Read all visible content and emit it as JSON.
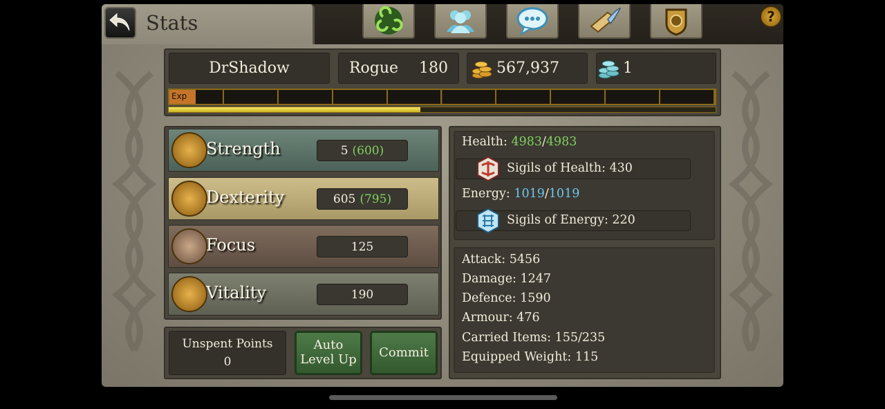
{
  "header": {
    "title": "Stats",
    "tabs": [
      {
        "icon": "triskelion-icon"
      },
      {
        "icon": "guild-icon"
      },
      {
        "icon": "chat-icon"
      },
      {
        "icon": "quest-scroll-icon"
      },
      {
        "icon": "crest-icon"
      }
    ],
    "help_label": "?"
  },
  "player": {
    "name": "DrShadow",
    "class": "Rogue",
    "level": "180",
    "gold": "567,937",
    "gems": "1"
  },
  "experience": {
    "label": "Exp",
    "segments": 10,
    "fill_fraction": 0.46
  },
  "attributes": [
    {
      "name": "Strength",
      "base": "5",
      "total": "(600)"
    },
    {
      "name": "Dexterity",
      "base": "605",
      "total": "(795)"
    },
    {
      "name": "Focus",
      "base": "125",
      "total": ""
    },
    {
      "name": "Vitality",
      "base": "190",
      "total": ""
    }
  ],
  "points": {
    "unspent_label": "Unspent Points",
    "unspent_value": "0",
    "auto_level_label_1": "Auto",
    "auto_level_label_2": "Level Up",
    "commit_label": "Commit"
  },
  "resources": {
    "health_label": "Health:",
    "health_current": "4983",
    "health_sep": "/",
    "health_max": "4983",
    "sigils_health": "Sigils of Health: 430",
    "energy_label": "Energy:",
    "energy_current": "1019",
    "energy_sep": "/",
    "energy_max": "1019",
    "sigils_energy": "Sigils of Energy: 220"
  },
  "combat": [
    "Attack: 5456",
    "Damage: 1247",
    "Defence: 1590",
    "Armour: 476",
    "Carried Items: 155/235",
    "Equipped Weight: 115"
  ],
  "colors": {
    "health_value": "#7fd25e",
    "energy_value": "#6dc8f0",
    "strength_row": "#5c7268",
    "dexterity_row": "#bcac7a",
    "focus_row": "#6e5e50",
    "vitality_row": "#707262",
    "button_green": "#3e6a38"
  }
}
